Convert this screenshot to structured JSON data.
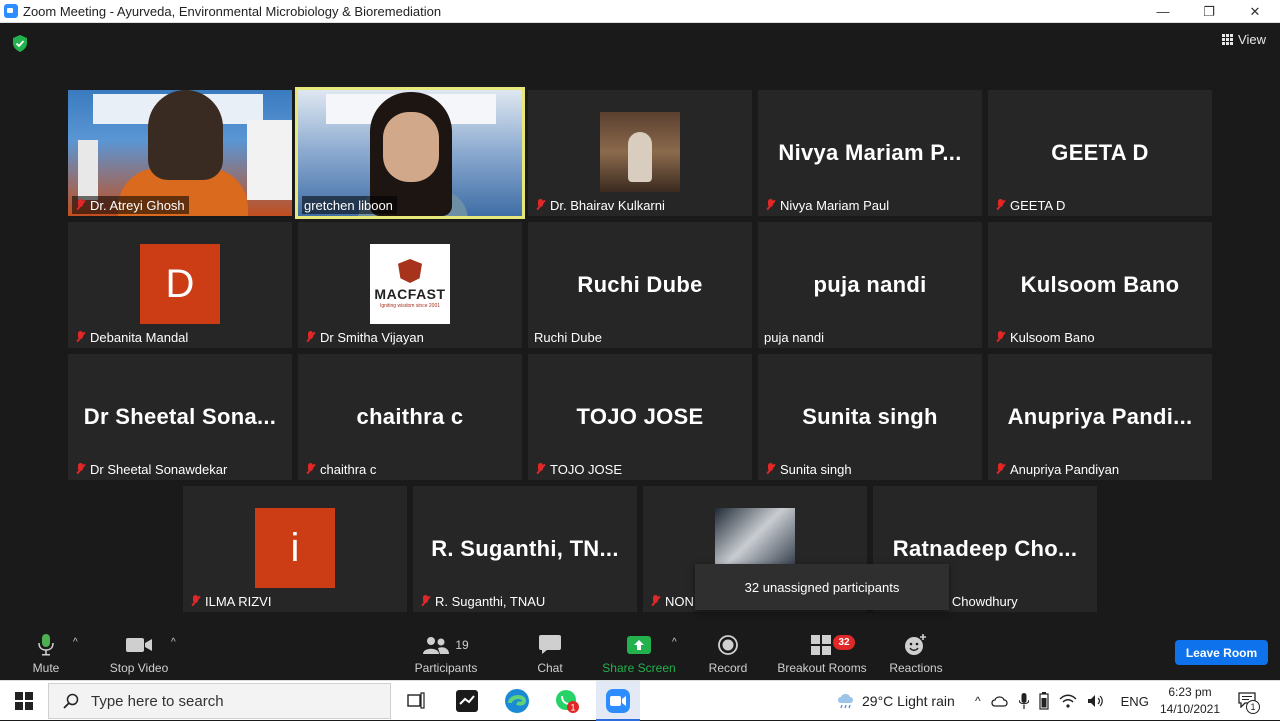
{
  "window": {
    "title": "Zoom Meeting - Ayurveda, Environmental Microbiology & Bioremediation",
    "min": "—",
    "max": "❐",
    "close": "✕"
  },
  "header": {
    "view_label": "View"
  },
  "participants": [
    {
      "name": "Dr. Atreyi Ghosh",
      "display": "",
      "muted": true
    },
    {
      "name": "gretchen liboon",
      "display": "",
      "muted": false,
      "active_speaker": true
    },
    {
      "name": "Dr. Bhairav Kulkarni",
      "display": "",
      "muted": true
    },
    {
      "name": "Nivya Mariam Paul",
      "display": "Nivya  Mariam  P...",
      "muted": true
    },
    {
      "name": "GEETA D",
      "display": "GEETA D",
      "muted": true
    },
    {
      "name": "Debanita Mandal",
      "display": "D",
      "muted": true
    },
    {
      "name": "Dr Smitha Vijayan",
      "display": "MACFAST",
      "display_sub": "Igniting wisdom since 2001",
      "muted": true
    },
    {
      "name": "Ruchi Dube",
      "display": "Ruchi Dube",
      "muted": false
    },
    {
      "name": "puja nandi",
      "display": "puja nandi",
      "muted": false
    },
    {
      "name": "Kulsoom Bano",
      "display": "Kulsoom Bano",
      "muted": true
    },
    {
      "name": "Dr Sheetal Sonawdekar",
      "display": "Dr  Sheetal  Sona...",
      "muted": true
    },
    {
      "name": "chaithra c",
      "display": "chaithra c",
      "muted": true
    },
    {
      "name": "TOJO JOSE",
      "display": "TOJO JOSE",
      "muted": true
    },
    {
      "name": "Sunita singh",
      "display": "Sunita singh",
      "muted": true
    },
    {
      "name": "Anupriya Pandiyan",
      "display": "Anupriya  Pandi...",
      "muted": true
    },
    {
      "name": "ILMA RIZVI",
      "display": "i",
      "muted": true
    },
    {
      "name": "R. Suganthi, TNAU",
      "display": "R.  Suganthi,  TN...",
      "muted": true
    },
    {
      "name": "NON",
      "display": "",
      "muted": true
    },
    {
      "name": "p Chowdhury",
      "display": "Ratnadeep  Cho...",
      "muted": false
    }
  ],
  "popup": {
    "text": "32 unassigned participants"
  },
  "toolbar": {
    "mute": "Mute",
    "stop_video": "Stop Video",
    "participants": "Participants",
    "participants_count": "19",
    "chat": "Chat",
    "share_screen": "Share Screen",
    "record": "Record",
    "breakout_rooms": "Breakout Rooms",
    "breakout_badge": "32",
    "reactions": "Reactions",
    "leave_room": "Leave Room"
  },
  "taskbar": {
    "search_placeholder": "Type here to search",
    "whatsapp_badge": "1",
    "weather": "29°C  Light rain",
    "lang": "ENG",
    "time": "6:23 pm",
    "date": "14/10/2021",
    "notif_count": "1"
  },
  "colors": {
    "accent": "#0e72ed",
    "active_speaker_border": "#e8e87a",
    "share_green": "#23b14d",
    "muted_red": "#e02828"
  }
}
